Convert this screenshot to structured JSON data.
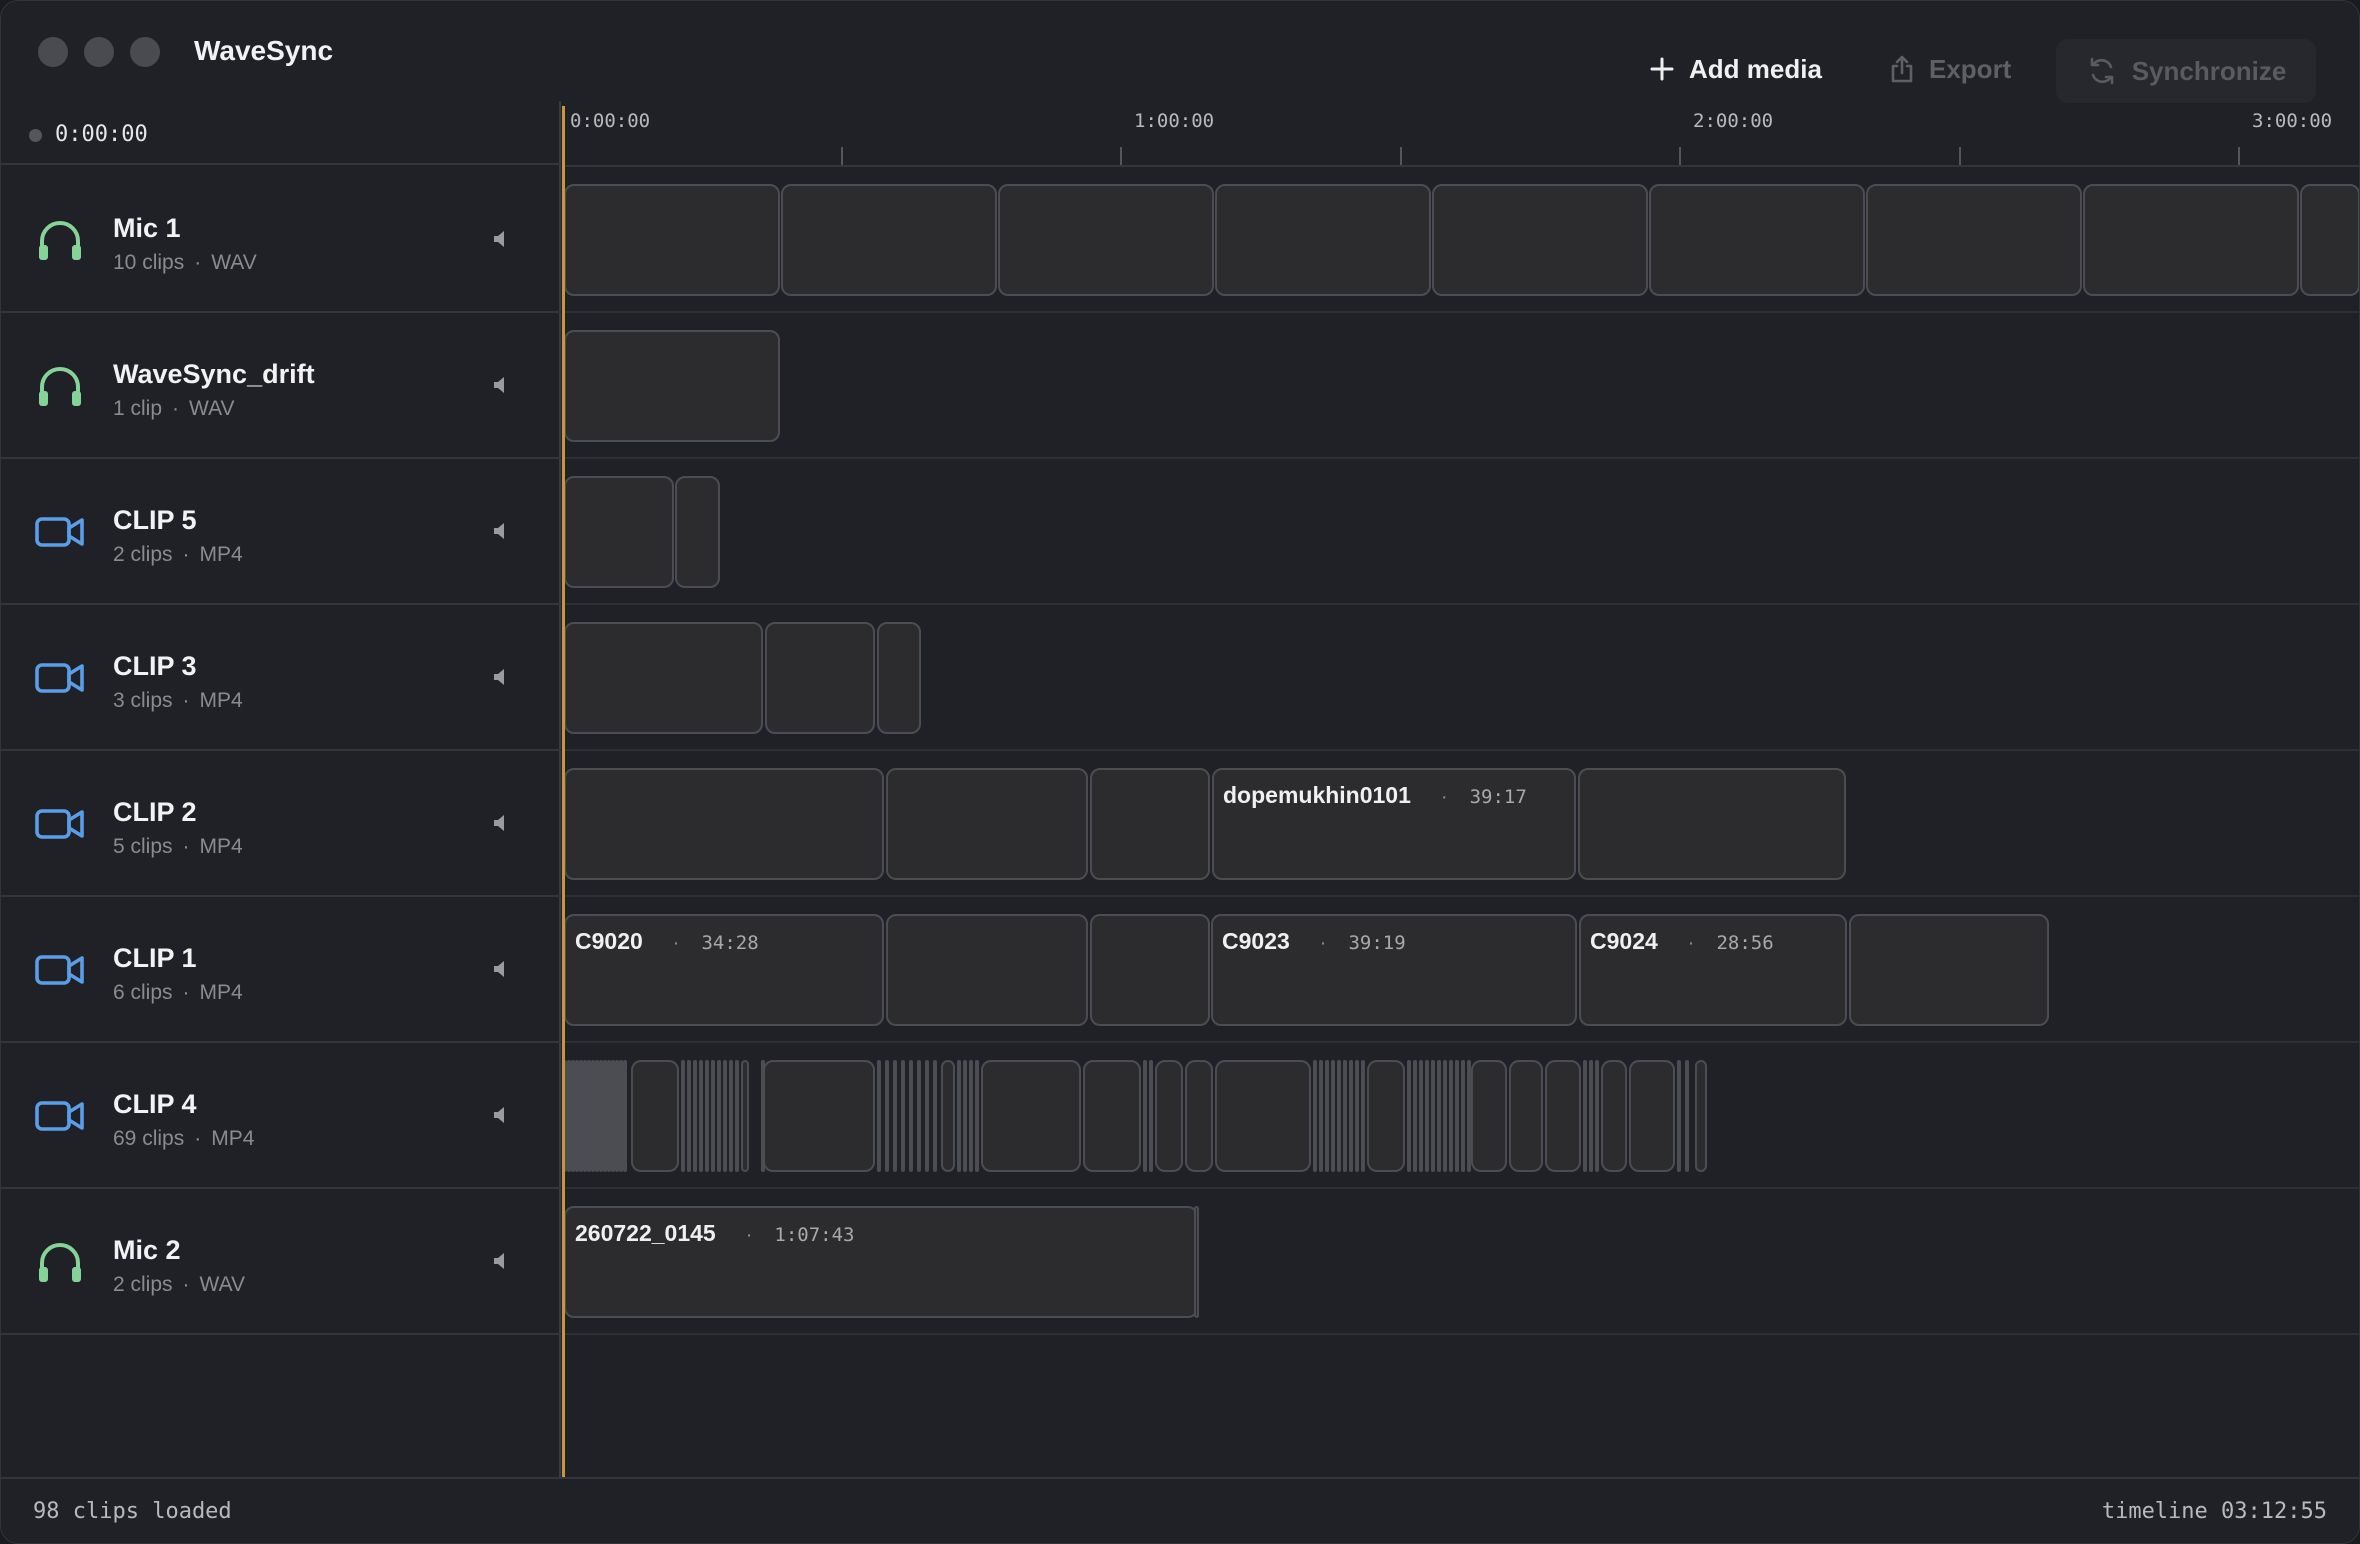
{
  "app": {
    "title": "WaveSync"
  },
  "toolbar": {
    "add_media_label": "Add media",
    "export_label": "Export",
    "synchronize_label": "Synchronize"
  },
  "timecode": "0:00:00",
  "ruler": {
    "labels": [
      "0:00:00",
      "1:00:00",
      "2:00:00",
      "3:00:00"
    ]
  },
  "tracks": [
    {
      "name": "Mic 1",
      "count": "10 clips",
      "format": "WAV",
      "icon": "headphones-icon",
      "icon_color": "#86d39a"
    },
    {
      "name": "WaveSync_drift",
      "count": "1 clip",
      "format": "WAV",
      "icon": "headphones-icon",
      "icon_color": "#86d39a"
    },
    {
      "name": "CLIP 5",
      "count": "2 clips",
      "format": "MP4",
      "icon": "video-camera-icon",
      "icon_color": "#5b9ee8"
    },
    {
      "name": "CLIP 3",
      "count": "3 clips",
      "format": "MP4",
      "icon": "video-camera-icon",
      "icon_color": "#5b9ee8"
    },
    {
      "name": "CLIP 2",
      "count": "5 clips",
      "format": "MP4",
      "icon": "video-camera-icon",
      "icon_color": "#5b9ee8"
    },
    {
      "name": "CLIP 1",
      "count": "6 clips",
      "format": "MP4",
      "icon": "video-camera-icon",
      "icon_color": "#5b9ee8"
    },
    {
      "name": "CLIP 4",
      "count": "69 clips",
      "format": "MP4",
      "icon": "video-camera-icon",
      "icon_color": "#5b9ee8"
    },
    {
      "name": "Mic 2",
      "count": "2 clips",
      "format": "WAV",
      "icon": "headphones-icon",
      "icon_color": "#86d39a"
    }
  ],
  "clip_labels": {
    "clip2_c4": {
      "name": "dopemukhin0101",
      "sep": "·",
      "duration": "39:17"
    },
    "clip1_c1": {
      "name": "C9020",
      "sep": "·",
      "duration": "34:28"
    },
    "clip1_c4": {
      "name": "C9023",
      "sep": "·",
      "duration": "39:19"
    },
    "clip1_c5": {
      "name": "C9024",
      "sep": "·",
      "duration": "28:56"
    },
    "mic2_c1": {
      "name": "260722_0145",
      "sep": "·",
      "duration": "1:07:43"
    }
  },
  "status": {
    "clips_loaded": "98 clips loaded",
    "timeline": "timeline 03:12:55"
  },
  "colors": {
    "playhead": "#c8963e",
    "headphones": "#86d39a",
    "camera": "#5b9ee8"
  }
}
